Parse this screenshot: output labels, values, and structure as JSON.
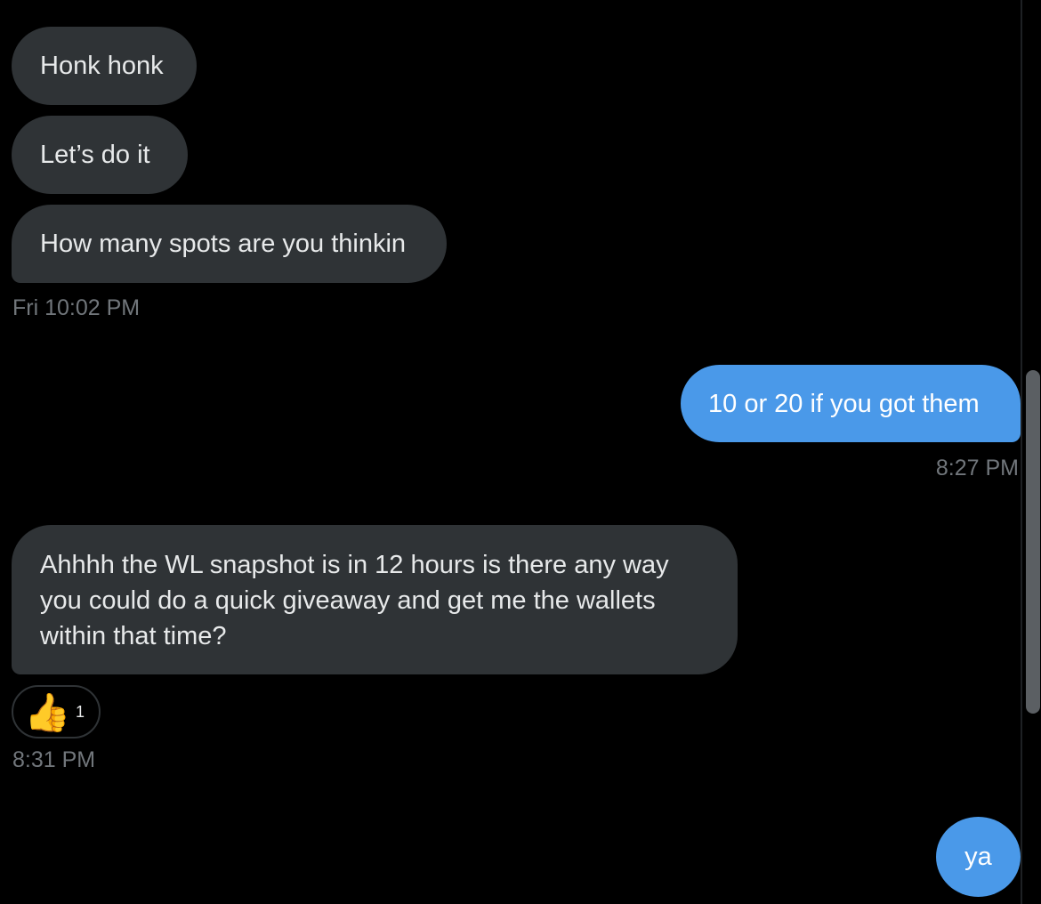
{
  "conversation": {
    "messages": [
      {
        "text": "Honk honk",
        "direction": "incoming"
      },
      {
        "text": "Let’s do it",
        "direction": "incoming"
      },
      {
        "text": "How many spots are you thinkin",
        "direction": "incoming",
        "timestamp": "Fri 10:02 PM"
      },
      {
        "text": "10 or 20 if you got them",
        "direction": "outgoing",
        "timestamp": "8:27 PM"
      },
      {
        "lines": [
          "Ahhhh the WL snapshot is in 12 hours is there any way",
          "you could do a quick giveaway and get me the wallets",
          "within that time?"
        ],
        "direction": "incoming",
        "reaction": {
          "emoji": "👍",
          "icon": "thumbs-up-emoji",
          "count": "1"
        },
        "timestamp": "8:31 PM"
      },
      {
        "text": "ya",
        "direction": "outgoing"
      }
    ]
  },
  "colors": {
    "background": "#000000",
    "incoming_bubble": "#2f3336",
    "outgoing_bubble": "#4a99e9",
    "timestamp_text": "#71767b"
  }
}
